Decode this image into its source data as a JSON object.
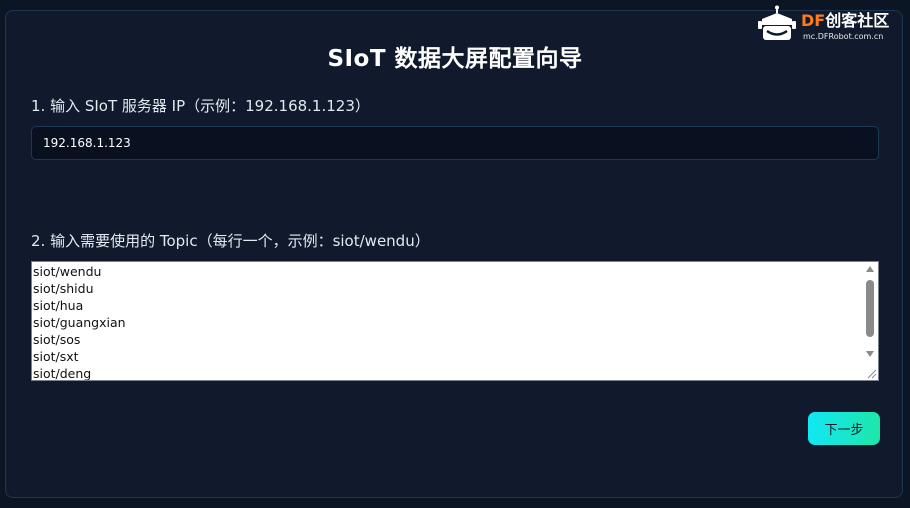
{
  "watermark": {
    "brand_prefix": "DF",
    "brand_suffix": "创客社区",
    "domain": "mc.DFRobot.com.cn",
    "logo_icon": "robot-head-icon"
  },
  "wizard": {
    "title": "SIoT 数据大屏配置向导",
    "step1": {
      "label": "1. 输入 SIoT 服务器 IP（示例：192.168.1.123）",
      "value": "192.168.1.123"
    },
    "step2": {
      "label": "2. 输入需要使用的 Topic（每行一个，示例：siot/wendu）",
      "topics": [
        "siot/wendu",
        "siot/shidu",
        "siot/hua",
        "siot/guangxian",
        "siot/sos",
        "siot/sxt",
        "siot/deng"
      ]
    },
    "next_label": "下一步"
  },
  "colors": {
    "background": "#0c1524",
    "panel": "#111a2c",
    "accent_start": "#12e7f5",
    "accent_end": "#1de7a8",
    "brand_orange": "#ff7a1a"
  }
}
